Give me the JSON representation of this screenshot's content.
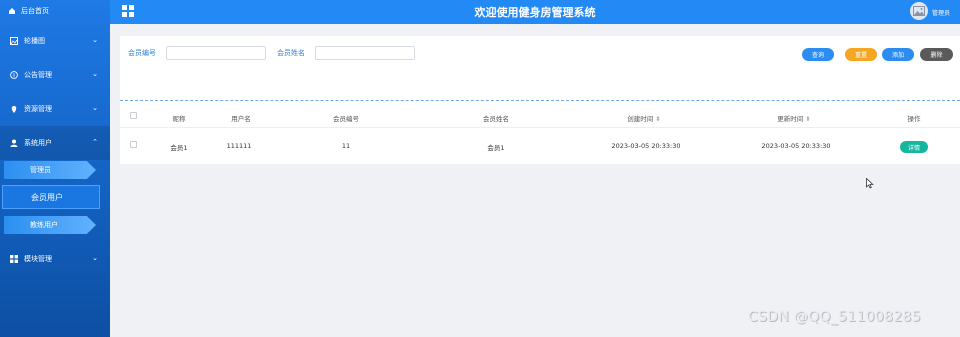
{
  "sidebar": {
    "home": "后台首页",
    "items": [
      {
        "label": "轮播图",
        "icon": "image-icon"
      },
      {
        "label": "公告管理",
        "icon": "info-icon"
      },
      {
        "label": "资源管理",
        "icon": "location-icon"
      },
      {
        "label": "系统用户",
        "icon": "user-icon"
      },
      {
        "label": "模块管理",
        "icon": "grid-icon"
      }
    ],
    "subitems": [
      "管理员",
      "会员用户",
      "教练用户"
    ]
  },
  "header": {
    "title": "欢迎使用健身房管理系统",
    "user": "管理员"
  },
  "search": {
    "member_no_label": "会员编号",
    "member_name_label": "会员姓名",
    "member_no_value": "",
    "member_name_value": ""
  },
  "buttons": {
    "query": "查询",
    "reset": "重置",
    "add": "添加",
    "delete": "删除"
  },
  "table": {
    "headers": [
      "昵称",
      "用户名",
      "会员编号",
      "会员姓名",
      "创建时间",
      "更新时间",
      "操作"
    ],
    "rows": [
      {
        "nickname": "会员1",
        "username": "111111",
        "member_no": "11",
        "member_name": "会员1",
        "created": "2023-03-05 20:33:30",
        "updated": "2023-03-05 20:33:30",
        "action": "详情"
      }
    ]
  },
  "watermark": "CSDN @QQ_511008285",
  "colors": {
    "sidebar": "#1566c8",
    "header": "#2389f5",
    "query": "#2d8cf0",
    "reset": "#f5a623",
    "add": "#2d8cf0",
    "delete": "#5a5a5a",
    "detail": "#16b5a0"
  }
}
